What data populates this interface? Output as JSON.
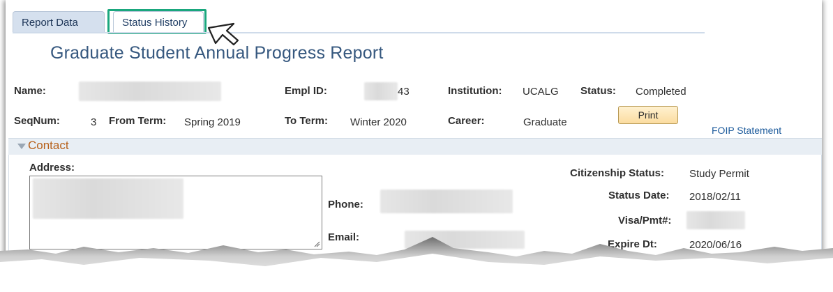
{
  "tabs": {
    "report_data": "Report Data",
    "status_history": "Status History"
  },
  "page_title": "Graduate Student Annual Progress Report",
  "header": {
    "name_label": "Name:",
    "emplid_label": "Empl ID:",
    "emplid_value": "43",
    "institution_label": "Institution:",
    "institution_value": "UCALG",
    "status_label": "Status:",
    "status_value": "Completed",
    "seqnum_label": "SeqNum:",
    "seqnum_value": "3",
    "from_term_label": "From Term:",
    "from_term_value": "Spring 2019",
    "to_term_label": "To Term:",
    "to_term_value": "Winter 2020",
    "career_label": "Career:",
    "career_value": "Graduate",
    "print_label": "Print",
    "foip_label": "FOIP Statement"
  },
  "contact": {
    "section_title": "Contact",
    "address_label": "Address:",
    "phone_label": "Phone:",
    "email_label": "Email:",
    "citizenship_label": "Citizenship Status:",
    "citizenship_value": "Study Permit",
    "status_date_label": "Status Date:",
    "status_date_value": "2018/02/11",
    "visa_label": "Visa/Pmt#:",
    "expire_label": "Expire Dt:",
    "expire_value": "2020/06/16"
  },
  "colors": {
    "highlight": "#1aa77d",
    "title": "#36587f",
    "section_title": "#b7611b",
    "link": "#1d5b9c",
    "print_button": "#fbdca0"
  },
  "icons": {
    "cursor": "mouse-pointer-icon",
    "collapse": "triangle-down-icon",
    "resize": "resize-grip-icon"
  }
}
